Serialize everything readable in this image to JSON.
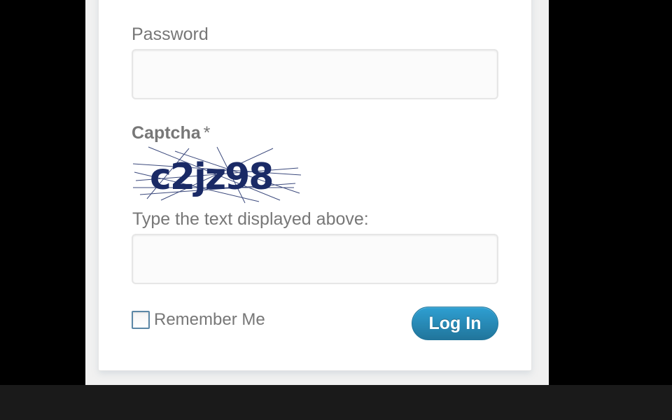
{
  "form": {
    "password_label": "Password",
    "password_value": "",
    "captcha_label": "Captcha",
    "captcha_required_mark": "*",
    "captcha_text": "c2jz98",
    "captcha_prompt": "Type the text displayed above:",
    "captcha_value": "",
    "remember_label": "Remember Me",
    "remember_checked": false,
    "login_label": "Log In"
  },
  "colors": {
    "button": "#21759b",
    "captcha_ink": "#1a2a66",
    "background": "#000000"
  }
}
